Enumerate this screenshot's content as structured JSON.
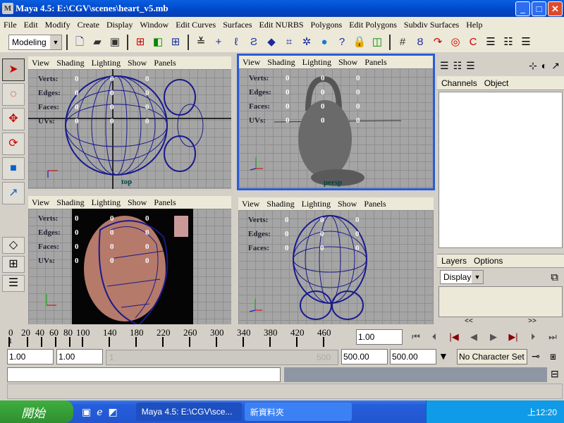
{
  "window": {
    "title": "Maya 4.5: E:\\CGV\\scenes\\heart_v5.mb",
    "app_icon": "maya-icon",
    "controls": [
      "minimize",
      "maximize",
      "close"
    ]
  },
  "menubar": [
    "File",
    "Edit",
    "Modify",
    "Create",
    "Display",
    "Window",
    "Edit Curves",
    "Surfaces",
    "Edit NURBS",
    "Polygons",
    "Edit Polygons",
    "Subdiv Surfaces",
    "Help"
  ],
  "toolbar": {
    "mode": "Modeling"
  },
  "viewport_menu": [
    "View",
    "Shading",
    "Lighting",
    "Show",
    "Panels"
  ],
  "hud": {
    "labels": [
      "Verts:",
      "Edges:",
      "Faces:",
      "UVs:"
    ],
    "value": "0"
  },
  "viewports": [
    {
      "label": "top"
    },
    {
      "label": "persp",
      "active": true
    },
    {
      "label": ""
    },
    {
      "label": ""
    }
  ],
  "right_panel": {
    "channels_tabs": [
      "Channels",
      "Object"
    ],
    "layers_tabs": [
      "Layers",
      "Options"
    ],
    "layer_dropdown": "Display",
    "scroll_left": "<<",
    "scroll_right": ">>"
  },
  "timeline": {
    "ticks": [
      "0",
      "20",
      "40",
      "60",
      "80",
      "100",
      "140",
      "180",
      "220",
      "260",
      "300",
      "340",
      "380",
      "420",
      "460"
    ],
    "current_frame": "1.00",
    "marker": "1"
  },
  "range": {
    "start": "1.00",
    "playback_start": "1.00",
    "slider_start": "1",
    "slider_end": "500",
    "playback_end": "500.00",
    "end": "500.00",
    "character_set": "No Character Set"
  },
  "colors": {
    "title": "#0046c8",
    "active_border": "#2a5cd8",
    "wireframe": "#1a1a8c",
    "grid": "#a5a5a5"
  },
  "taskbar": {
    "start": "開始",
    "tasks": [
      "Maya 4.5: E:\\CGV\\sce...",
      "新資料夾"
    ],
    "clock": "上12:20"
  }
}
